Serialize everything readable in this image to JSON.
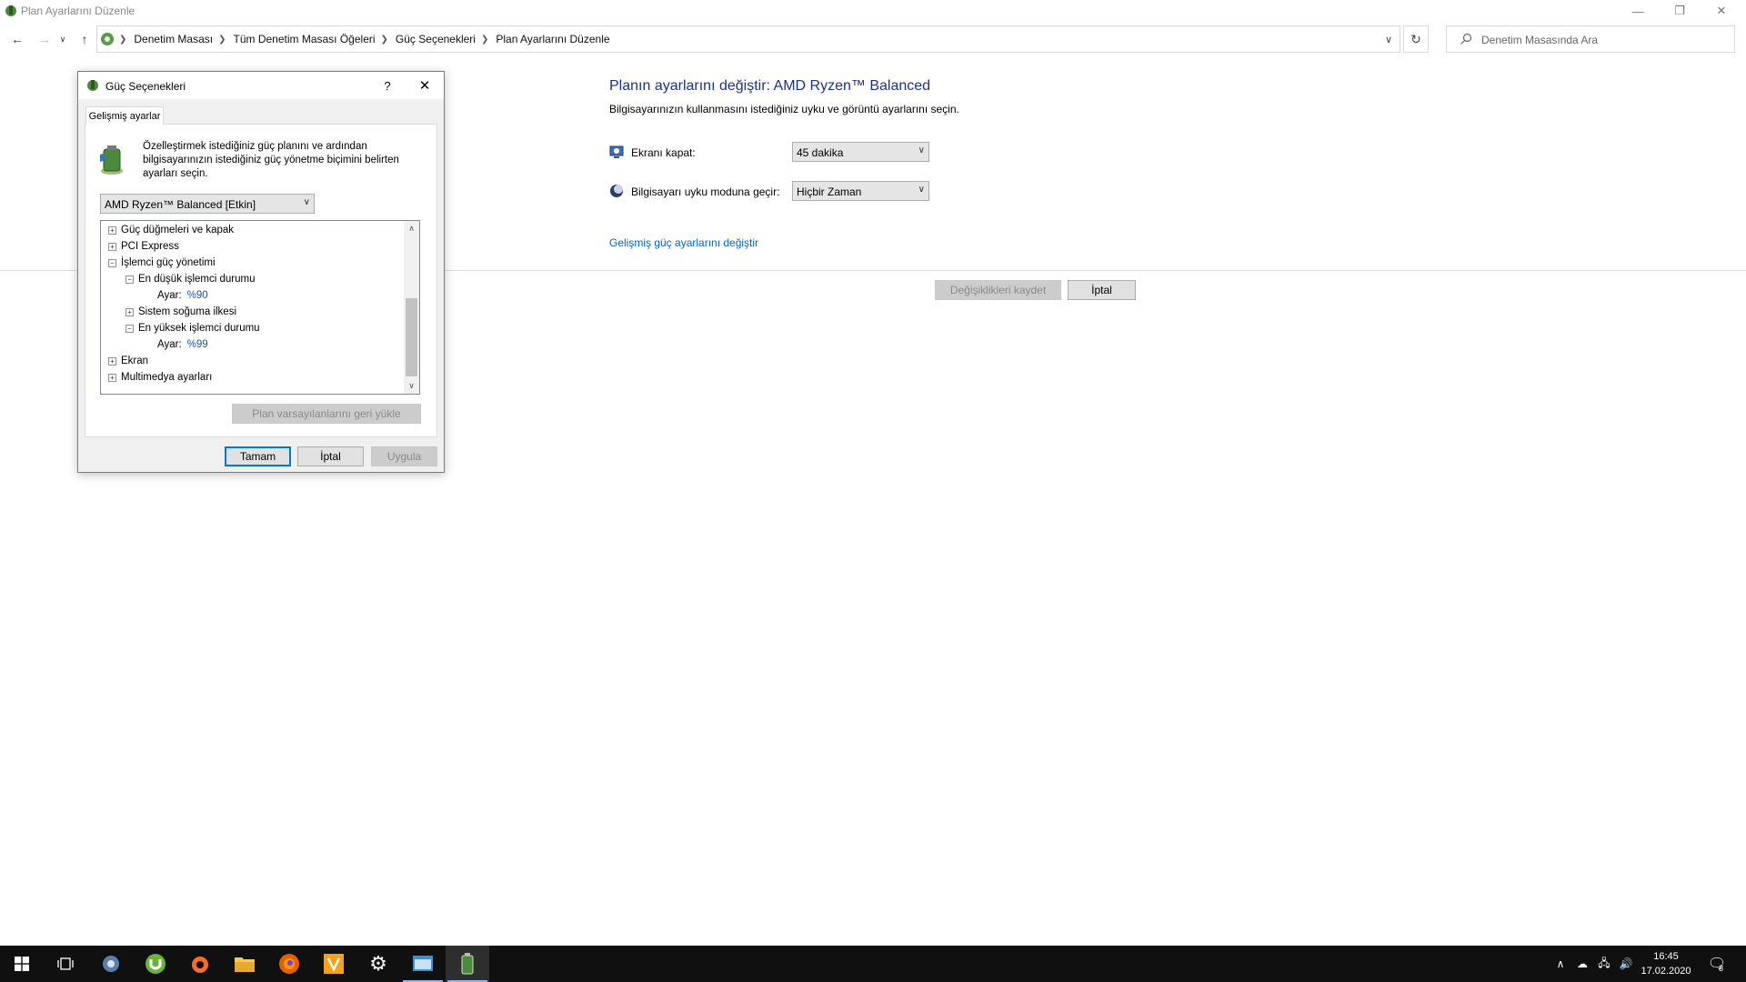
{
  "window": {
    "title": "Plan Ayarlarını Düzenle",
    "minimize_icon": "minimize-icon",
    "restore_icon": "restore-icon",
    "close_icon": "close-icon"
  },
  "navigation": {
    "breadcrumbs": [
      "Denetim Masası",
      "Tüm Denetim Masası Öğeleri",
      "Güç Seçenekleri",
      "Plan Ayarlarını Düzenle"
    ],
    "search_placeholder": "Denetim Masasında Ara"
  },
  "main": {
    "title": "Planın ayarlarını değiştir: AMD Ryzen™ Balanced",
    "subtitle": "Bilgisayarınızın kullanmasını istediğiniz uyku ve görüntü ayarlarını seçin.",
    "display_off": {
      "label": "Ekranı kapat:",
      "value": "45 dakika"
    },
    "sleep": {
      "label": "Bilgisayarı uyku moduna geçir:",
      "value": "Hiçbir Zaman"
    },
    "advanced_link": "Gelişmiş güç ayarlarını değiştir",
    "save_button": "Değişiklikleri kaydet",
    "cancel_button": "İptal"
  },
  "dialog": {
    "title": "Güç Seçenekleri",
    "help": "?",
    "tab": "Gelişmiş ayarlar",
    "intro": "Özelleştirmek istediğiniz güç planını ve ardından bilgisayarınızın istediğiniz güç yönetme biçimini belirten ayarları seçin.",
    "plan_select": "AMD Ryzen™ Balanced [Etkin]",
    "tree": [
      {
        "label": "Güç düğmeleri ve kapak",
        "expander": "+"
      },
      {
        "label": "PCI Express",
        "expander": "+"
      },
      {
        "label": "İşlemci güç yönetimi",
        "expander": "−"
      },
      {
        "label": "En düşük işlemci durumu",
        "expander": "−"
      },
      {
        "label": "Ayar:",
        "value": "%90"
      },
      {
        "label": "Sistem soğuma ilkesi",
        "expander": "+"
      },
      {
        "label": "En yüksek işlemci durumu",
        "expander": "−"
      },
      {
        "label": "Ayar:",
        "value": "%99"
      },
      {
        "label": "Ekran",
        "expander": "+"
      },
      {
        "label": "Multimedya ayarları",
        "expander": "+"
      }
    ],
    "restore_defaults": "Plan varsayılanlarını geri yükle",
    "ok": "Tamam",
    "cancel": "İptal",
    "apply": "Uygula"
  },
  "taskbar": {
    "time": "16:45",
    "date": "17.02.2020",
    "notification_count": "8",
    "colors": {
      "background": "#101010",
      "accent": "#8ab6e8"
    }
  }
}
